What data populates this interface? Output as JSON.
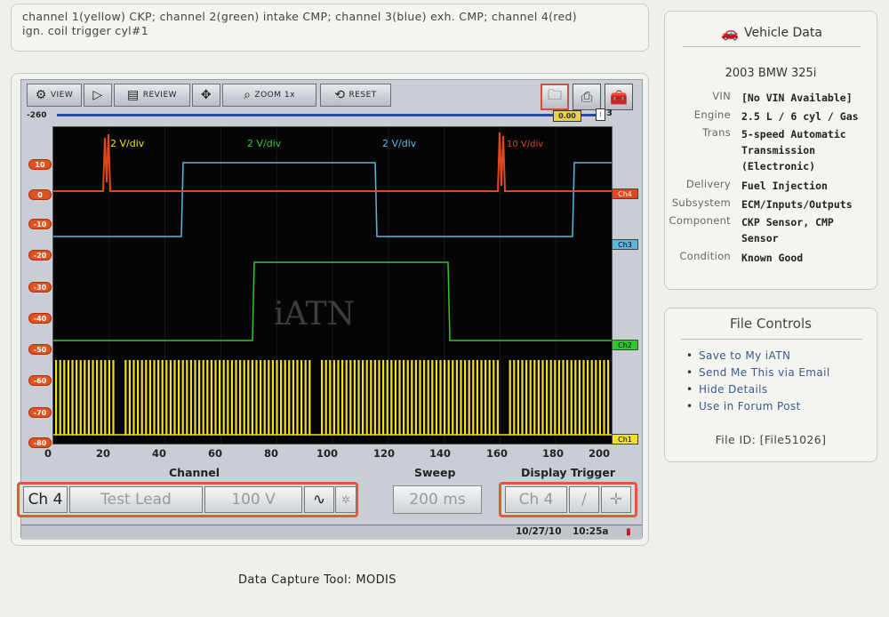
{
  "description": {
    "line1": "channel 1(yellow) CKP; channel 2(green) intake CMP; channel 3(blue) exh. CMP; channel 4(red)",
    "line2": "ign. coil trigger cyl#1"
  },
  "toolbar": {
    "view_label": "VIEW",
    "review_label": "REVIEW",
    "zoom_label": "ZOOM 1x",
    "reset_label": "RESET"
  },
  "slider": {
    "left_value": "-260",
    "knob_value": "0.00",
    "right_value": "3"
  },
  "plot": {
    "watermark": "iATN",
    "ch_scales": [
      "2 V/div",
      "2 V/div",
      "2 V/div",
      "10 V/div"
    ],
    "y_ticks": [
      "10",
      "0",
      "-10",
      "-20",
      "-30",
      "-40",
      "-50",
      "-60",
      "-70",
      "-80"
    ],
    "x_ticks": [
      "0",
      "20",
      "40",
      "60",
      "80",
      "100",
      "120",
      "140",
      "160",
      "180",
      "200"
    ],
    "channels": [
      {
        "label": "Ch4",
        "color": "#e0481e"
      },
      {
        "label": "Ch3",
        "color": "#5ab8e0"
      },
      {
        "label": "Ch2",
        "color": "#2ec82e"
      },
      {
        "label": "Ch1",
        "color": "#f0e020"
      }
    ]
  },
  "controls": {
    "channel_title": "Channel",
    "sweep_title": "Sweep",
    "trigger_title": "Display Trigger",
    "channel_value": "Ch 4",
    "probe_value": "Test Lead",
    "range_value": "100 V",
    "sweep_value": "200 ms",
    "trigger_channel": "Ch 4"
  },
  "status": {
    "date": "10/27/10",
    "time": "10:25a"
  },
  "footer": "Data Capture Tool: MODIS",
  "vehicle": {
    "title": "Vehicle Data",
    "model": "2003 BMW 325i",
    "rows": [
      {
        "label": "VIN",
        "value": "[No VIN Available]"
      },
      {
        "label": "Engine",
        "value": "2.5 L / 6 cyl / Gas"
      },
      {
        "label": "Trans",
        "value": "5-speed Automatic Transmission (Electronic)"
      },
      {
        "label": "Delivery",
        "value": "Fuel Injection"
      },
      {
        "label": "Subsystem",
        "value": "ECM/Inputs/Outputs"
      },
      {
        "label": "Component",
        "value": "CKP Sensor, CMP Sensor"
      },
      {
        "label": "Condition",
        "value": "Known Good"
      }
    ]
  },
  "file_controls": {
    "title": "File Controls",
    "items": [
      "Save to My iATN",
      "Send Me This via Email",
      "Hide Details",
      "Use in Forum Post"
    ],
    "file_id": "File ID: [File51026]"
  }
}
